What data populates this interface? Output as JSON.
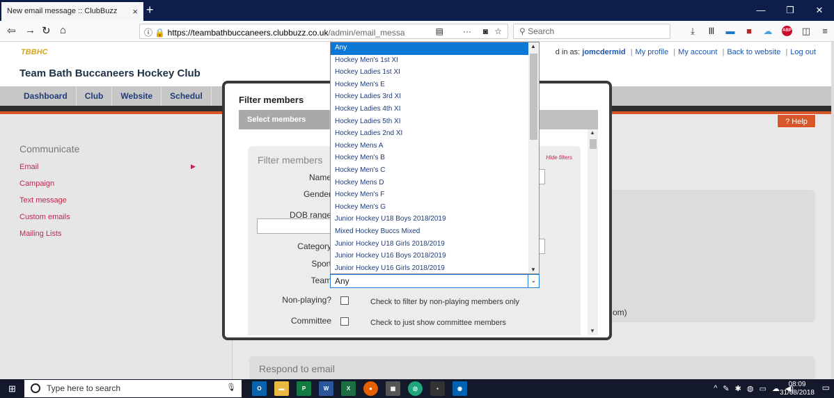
{
  "browser": {
    "tab_title": "New email message :: ClubBuzz",
    "tab_close": "×",
    "new_tab": "+",
    "url_domain": "https://teambathbuccaneers.clubbuzz.co.uk",
    "url_path": "/admin/email_messa",
    "search_placeholder": "Search",
    "window_controls": [
      "—",
      "❐",
      "✕"
    ]
  },
  "site": {
    "logo_text": "TBBHC",
    "club_name": "Team Bath Buccaneers Hockey Club",
    "logged_in_prefix": "d in as:",
    "username": "jomcdermid",
    "user_links": [
      "My profile",
      "My account",
      "Back to website",
      "Log out"
    ],
    "nav": [
      "Dashboard",
      "Club",
      "Website",
      "Schedul"
    ],
    "help_label": "? Help"
  },
  "sidebar": {
    "title": "Communicate",
    "items": [
      "Email",
      "Campaign",
      "Text message",
      "Custom emails",
      "Mailing Lists"
    ]
  },
  "main": {
    "om_text": "om)",
    "respond_label": "Respond to email"
  },
  "modal": {
    "title": "Filter members",
    "tab_label": "Select members",
    "panel_title": "Filter members",
    "hide_filters": "Hide filters",
    "labels": {
      "name": "Name",
      "gender": "Gender",
      "dob_range": "DOB range",
      "category": "Category",
      "sport": "Sport",
      "team": "Team",
      "non_playing": "Non-playing?",
      "committee": "Committee"
    },
    "non_playing_text": "Check to filter by non-playing members only",
    "committee_text": "Check to just show committee members"
  },
  "team_select": {
    "value": "Any",
    "options": [
      "Any",
      "Hockey Men's 1st XI",
      "Hockey Ladies 1st XI",
      "Hockey Men's E",
      "Hockey Ladies 3rd XI",
      "Hockey Ladies 4th XI",
      "Hockey Ladies 5th XI",
      "Hockey Ladies 2nd XI",
      "Hockey Mens A",
      "Hockey Men's B",
      "Hockey Men's C",
      "Hockey Mens D",
      "Hockey Men's F",
      "Hockey Men's G",
      "Junior Hockey U18 Boys 2018/2019",
      "Mixed Hockey Buccs Mixed",
      "Junior Hockey U18 Girls 2018/2019",
      "Junior Hockey U16 Boys 2018/2019",
      "Junior Hockey U16 Girls 2018/2019"
    ],
    "selected_index": 0
  },
  "taskbar": {
    "search_placeholder": "Type here to search",
    "time": "08:09",
    "date": "31/08/2018"
  },
  "colors": {
    "accent_red": "#c0274d",
    "nav_blue": "#1f3b78",
    "help_orange": "#d7562a",
    "selection_blue": "#0b78d7"
  }
}
